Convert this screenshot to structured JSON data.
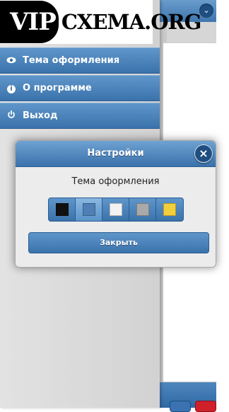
{
  "logo": {
    "part1": "VIP",
    "part2": "CXEMA.ORG"
  },
  "menu": {
    "items": [
      {
        "label": "Тема оформления",
        "icon": "eye-icon"
      },
      {
        "label": "О программе",
        "icon": "info-icon"
      },
      {
        "label": "Выход",
        "icon": "power-icon"
      }
    ]
  },
  "dialog": {
    "title": "Настройки",
    "section_label": "Тема оформления",
    "close_button_label": "Закрыть",
    "close_icon": "×",
    "themes": [
      {
        "name": "black",
        "color": "#111111",
        "selected": false
      },
      {
        "name": "blue",
        "color": "#4f7fb5",
        "selected": true
      },
      {
        "name": "white",
        "color": "#f2f2f2",
        "selected": false
      },
      {
        "name": "gray",
        "color": "#a9a9a9",
        "selected": false
      },
      {
        "name": "yellow",
        "color": "#f2cf3a",
        "selected": false
      }
    ]
  },
  "header": {
    "menu_icon": "chevron-down-icon",
    "menu_glyph": "⌄"
  },
  "colors": {
    "accent": "#3a72ab",
    "accent_dark": "#2a5d93",
    "footer_red": "#d0202a"
  }
}
